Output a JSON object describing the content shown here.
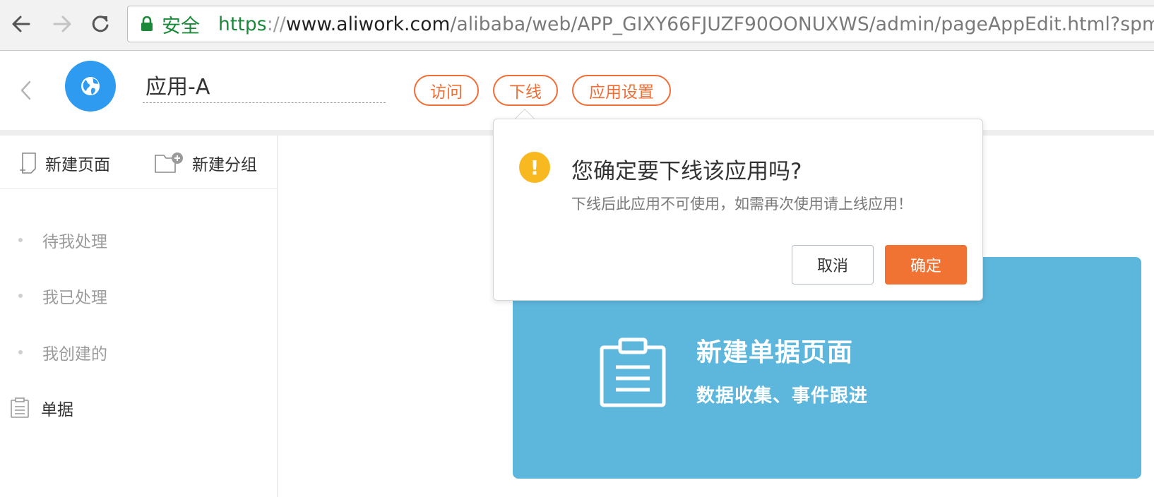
{
  "browser": {
    "secure_label": "安全",
    "url_protocol": "https",
    "url_separator": "://",
    "url_host": "www.aliwork.com",
    "url_path": "/alibaba/web/APP_GIXY66FJUZF90OONUXWS/admin/pageAppEdit.html?spm="
  },
  "header": {
    "app_name": "应用-A",
    "visit_label": "访问",
    "offline_label": "下线",
    "settings_label": "应用设置"
  },
  "sidebar": {
    "new_page_label": "新建页面",
    "new_group_label": "新建分组",
    "items": [
      {
        "label": "待我处理"
      },
      {
        "label": "我已处理"
      },
      {
        "label": "我创建的"
      },
      {
        "label": "单据"
      }
    ]
  },
  "card": {
    "title": "新建单据页面",
    "subtitle": "数据收集、事件跟进"
  },
  "popover": {
    "title": "您确定要下线该应用吗?",
    "description": "下线后此应用不可使用，如需再次使用请上线应用！",
    "warn_glyph": "!",
    "cancel_label": "取消",
    "ok_label": "确定"
  },
  "colors": {
    "accent_orange": "#ef6e36",
    "logo_blue": "#2e9bf0",
    "card_blue": "#5db7dc",
    "warning_yellow": "#f8b920",
    "secure_green": "#1a8a3a"
  }
}
